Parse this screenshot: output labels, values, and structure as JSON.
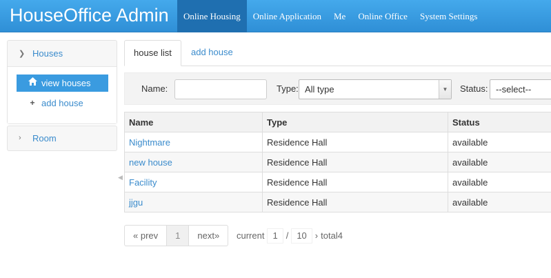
{
  "app": {
    "title": "HouseOffice Admin"
  },
  "nav": {
    "items": [
      {
        "label": "Online Housing",
        "active": true
      },
      {
        "label": "Online Application"
      },
      {
        "label": "Me"
      },
      {
        "label": "Online Office"
      },
      {
        "label": "System Settings"
      }
    ]
  },
  "sidebar": {
    "houses": {
      "label": "Houses",
      "icon": "chevron-down-icon",
      "items": [
        {
          "label": "view houses",
          "icon": "home-icon",
          "active": true
        },
        {
          "label": "add house",
          "icon": "plus-icon"
        }
      ]
    },
    "room": {
      "label": "Room",
      "icon": "chevron-right-icon"
    }
  },
  "tabs": [
    {
      "label": "house list",
      "active": true
    },
    {
      "label": "add house"
    }
  ],
  "filter": {
    "name_label": "Name:",
    "name_value": "",
    "type_label": "Type:",
    "type_value": "All type",
    "status_label": "Status:",
    "status_value": "--select--"
  },
  "table": {
    "columns": [
      "Name",
      "Type",
      "Status"
    ],
    "rows": [
      {
        "name": "Nightmare",
        "type": "Residence Hall",
        "status": "available"
      },
      {
        "name": "new house",
        "type": "Residence Hall",
        "status": "available"
      },
      {
        "name": "Facility",
        "type": "Residence Hall",
        "status": "available"
      },
      {
        "name": "jjgu",
        "type": "Residence Hall",
        "status": "available"
      }
    ]
  },
  "pagination": {
    "prev": "« prev",
    "page": "1",
    "next": "next»",
    "current_label": "current",
    "current_value": "1",
    "separator": "/",
    "page_size": "10",
    "total_arrow": "›",
    "total_label": "total4"
  },
  "colors": {
    "topbar": "#3a9be0",
    "nav_active": "#1f6fb0",
    "link": "#3a8bcc"
  }
}
